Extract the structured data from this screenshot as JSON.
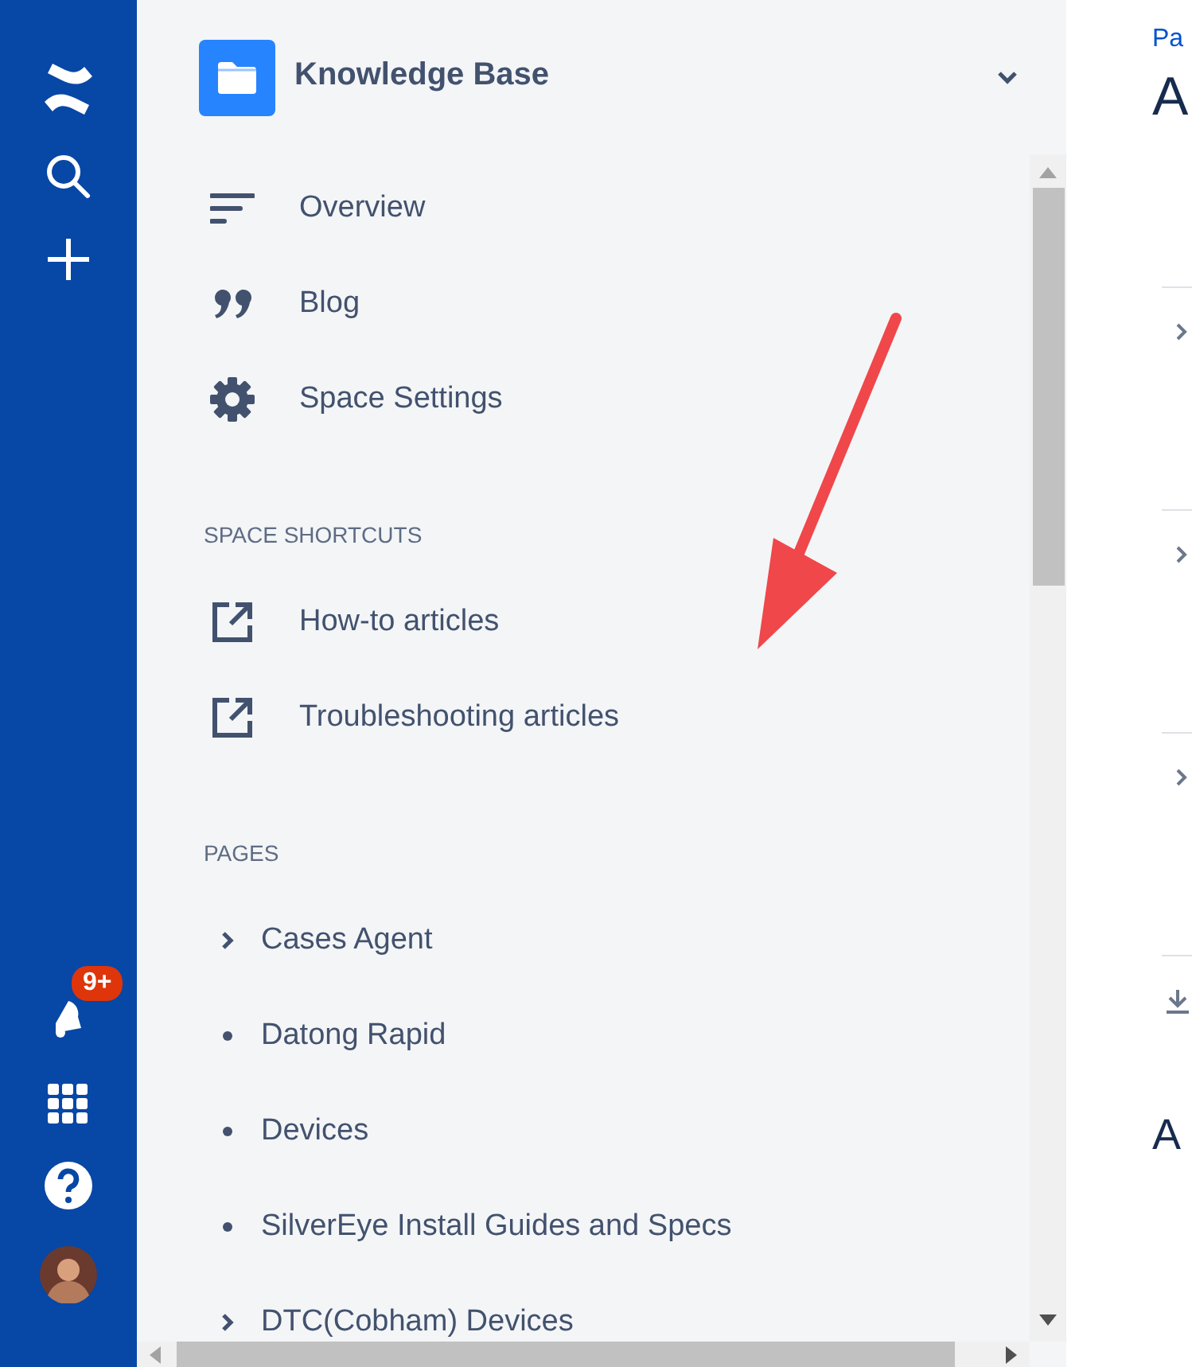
{
  "rail": {
    "notification_badge": "9+"
  },
  "space": {
    "name": "Knowledge Base"
  },
  "nav": [
    {
      "label": "Overview",
      "kind": "overview"
    },
    {
      "label": "Blog",
      "kind": "blog"
    },
    {
      "label": "Space Settings",
      "kind": "settings"
    }
  ],
  "shortcuts": {
    "heading": "SPACE SHORTCUTS",
    "items": [
      {
        "label": "How-to articles"
      },
      {
        "label": "Troubleshooting articles"
      }
    ]
  },
  "pages": {
    "heading": "PAGES",
    "items": [
      {
        "label": "Cases Agent",
        "expandable": true
      },
      {
        "label": "Datong Rapid",
        "expandable": false
      },
      {
        "label": "Devices",
        "expandable": false
      },
      {
        "label": "SilverEye Install Guides and Specs",
        "expandable": false
      },
      {
        "label": "DTC(Cobham) Devices",
        "expandable": true
      }
    ]
  },
  "content": {
    "breadcrumb": "Pa",
    "title": "A",
    "section_heading": "A"
  }
}
